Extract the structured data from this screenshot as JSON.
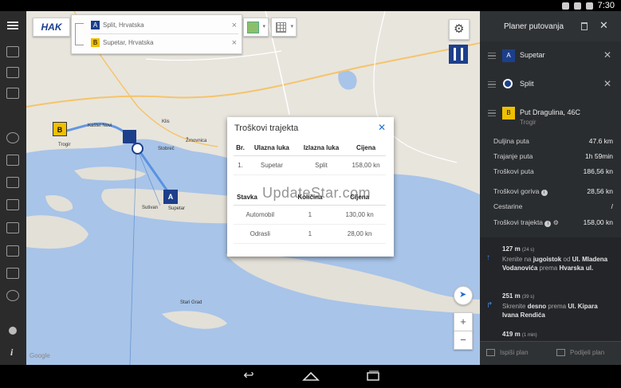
{
  "status_bar": {
    "time": "7:30"
  },
  "map": {
    "logo": "HAK",
    "route": {
      "from": {
        "marker": "A",
        "label": "Split, Hrvatska"
      },
      "to": {
        "marker": "B",
        "label": "Supetar, Hrvatska"
      }
    },
    "labels": [
      {
        "name": "Trogir",
        "text": "Trogir"
      },
      {
        "name": "Kastel-Novi",
        "text": "Kaštel Novi"
      },
      {
        "name": "Klis",
        "text": "Klis"
      },
      {
        "name": "Sutivan",
        "text": "Sutivan"
      },
      {
        "name": "Supetar",
        "text": "Supetar"
      },
      {
        "name": "Stari-Grad",
        "text": "Stari Grad"
      },
      {
        "name": "Zrnovnica",
        "text": "Žrnovnica"
      },
      {
        "name": "Stobrec",
        "text": "Stobreč"
      },
      {
        "name": "Google",
        "text": "Google"
      }
    ],
    "markers": {
      "a": "A",
      "b": "B"
    },
    "zoom_in": "+",
    "zoom_out": "−"
  },
  "dialog": {
    "title": "Troškovi trajekta",
    "table1": {
      "headers": [
        "Br.",
        "Ulazna luka",
        "Izlazna luka",
        "Cijena"
      ],
      "rows": [
        [
          "1.",
          "Supetar",
          "Split",
          "158,00 kn"
        ]
      ]
    },
    "table2": {
      "headers": [
        "Stavka",
        "Količina",
        "Cijena"
      ],
      "rows": [
        [
          "Automobil",
          "1",
          "130,00 kn"
        ],
        [
          "Odrasli",
          "1",
          "28,00 kn"
        ]
      ]
    }
  },
  "watermark": "UpdateStar.com",
  "panel": {
    "title": "Planer putovanja",
    "stops": [
      {
        "marker": "A",
        "label": "Supetar",
        "sub": ""
      },
      {
        "marker": "o",
        "label": "Split",
        "sub": ""
      },
      {
        "marker": "B",
        "label": "Put Dragulina, 46C",
        "sub": "Trogir"
      }
    ],
    "stats": [
      {
        "label": "Duljina puta",
        "value": "47.6 km"
      },
      {
        "label": "Trajanje puta",
        "value": "1h 59min"
      },
      {
        "label": "Troškovi puta",
        "value": "186,56 kn"
      },
      {
        "label": "Troškovi goriva",
        "value": "28,56 kn"
      },
      {
        "label": "Cestarine",
        "value": "/"
      },
      {
        "label": "Troškovi trajekta",
        "value": "158,00 kn"
      }
    ],
    "directions": [
      {
        "dist": "127 m",
        "time": "(24 s)",
        "pre": "Krenite na",
        "dir": "jugoistok",
        "mid": "od",
        "street": "Ul. Mladena Vodanovića",
        "post": "prema",
        "to": "Hvarska ul."
      },
      {
        "dist": "251 m",
        "time": "(39 s)",
        "pre": "Skrenite",
        "dir": "desno",
        "mid": "prema",
        "street": "Ul. Kipara Ivana Rendića",
        "post": "",
        "to": ""
      },
      {
        "dist": "419 m",
        "time": "(1 min)",
        "pre": "",
        "dir": "",
        "mid": "",
        "street": "",
        "post": "",
        "to": ""
      }
    ],
    "footer": {
      "print": "Ispiši plan",
      "share": "Podijeli plan"
    }
  }
}
